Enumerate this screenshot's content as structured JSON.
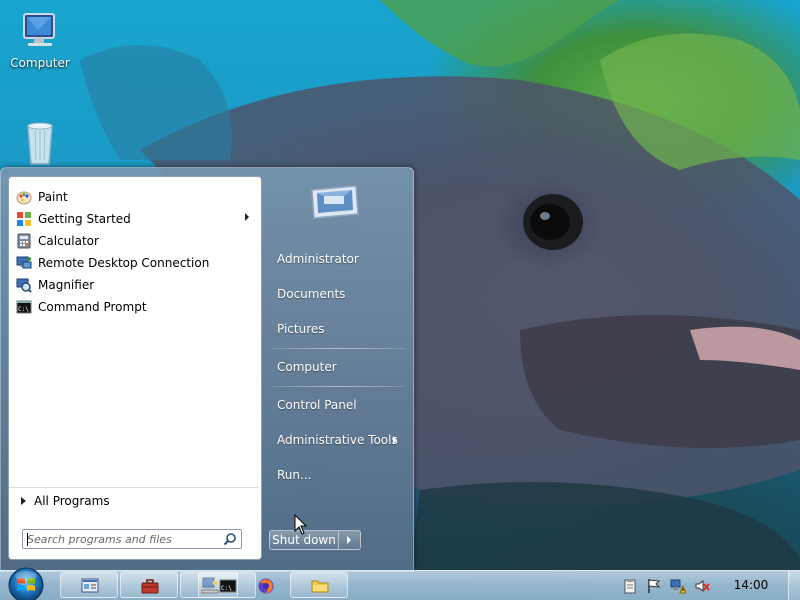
{
  "desktop": {
    "icons": [
      {
        "label": "Computer",
        "icon": "computer-icon"
      },
      {
        "label": "",
        "icon": "recycle-bin-icon"
      }
    ]
  },
  "start_menu": {
    "programs": [
      {
        "label": "Paint",
        "icon": "paint-icon",
        "has_submenu": false
      },
      {
        "label": "Getting Started",
        "icon": "getting-started-icon",
        "has_submenu": true
      },
      {
        "label": "Calculator",
        "icon": "calculator-icon",
        "has_submenu": false
      },
      {
        "label": "Remote Desktop Connection",
        "icon": "remote-desktop-icon",
        "has_submenu": false
      },
      {
        "label": "Magnifier",
        "icon": "magnifier-icon",
        "has_submenu": false
      },
      {
        "label": "Command Prompt",
        "icon": "command-prompt-icon",
        "has_submenu": false
      }
    ],
    "all_programs_label": "All Programs",
    "search": {
      "placeholder": "Search programs and files",
      "value": ""
    },
    "right_items": [
      {
        "label": "Administrator",
        "has_submenu": false
      },
      {
        "label": "Documents",
        "has_submenu": false
      },
      {
        "label": "Pictures",
        "has_submenu": false
      },
      {
        "label": "Computer",
        "has_submenu": false
      },
      {
        "label": "Control Panel",
        "has_submenu": false
      },
      {
        "label": "Administrative Tools",
        "has_submenu": true
      },
      {
        "label": "Run...",
        "has_submenu": false
      }
    ],
    "shutdown_label": "Shut down"
  },
  "taskbar": {
    "pinned": [
      {
        "icon": "remote-desktop-app-icon"
      },
      {
        "icon": "toolbox-icon"
      },
      {
        "icon": "network-computer-icon"
      },
      {
        "icon": "command-prompt-icon"
      },
      {
        "icon": "firefox-icon"
      },
      {
        "icon": "file-explorer-icon"
      }
    ],
    "tray_icons": [
      "clipboard-icon",
      "action-center-flag-icon",
      "network-warning-icon",
      "volume-muted-icon"
    ],
    "clock": "14:00"
  },
  "colors": {
    "menu_glass": "#6f8ba6",
    "taskbar_glass": "#aac8e0",
    "desktop_water": "#17a5cf"
  }
}
